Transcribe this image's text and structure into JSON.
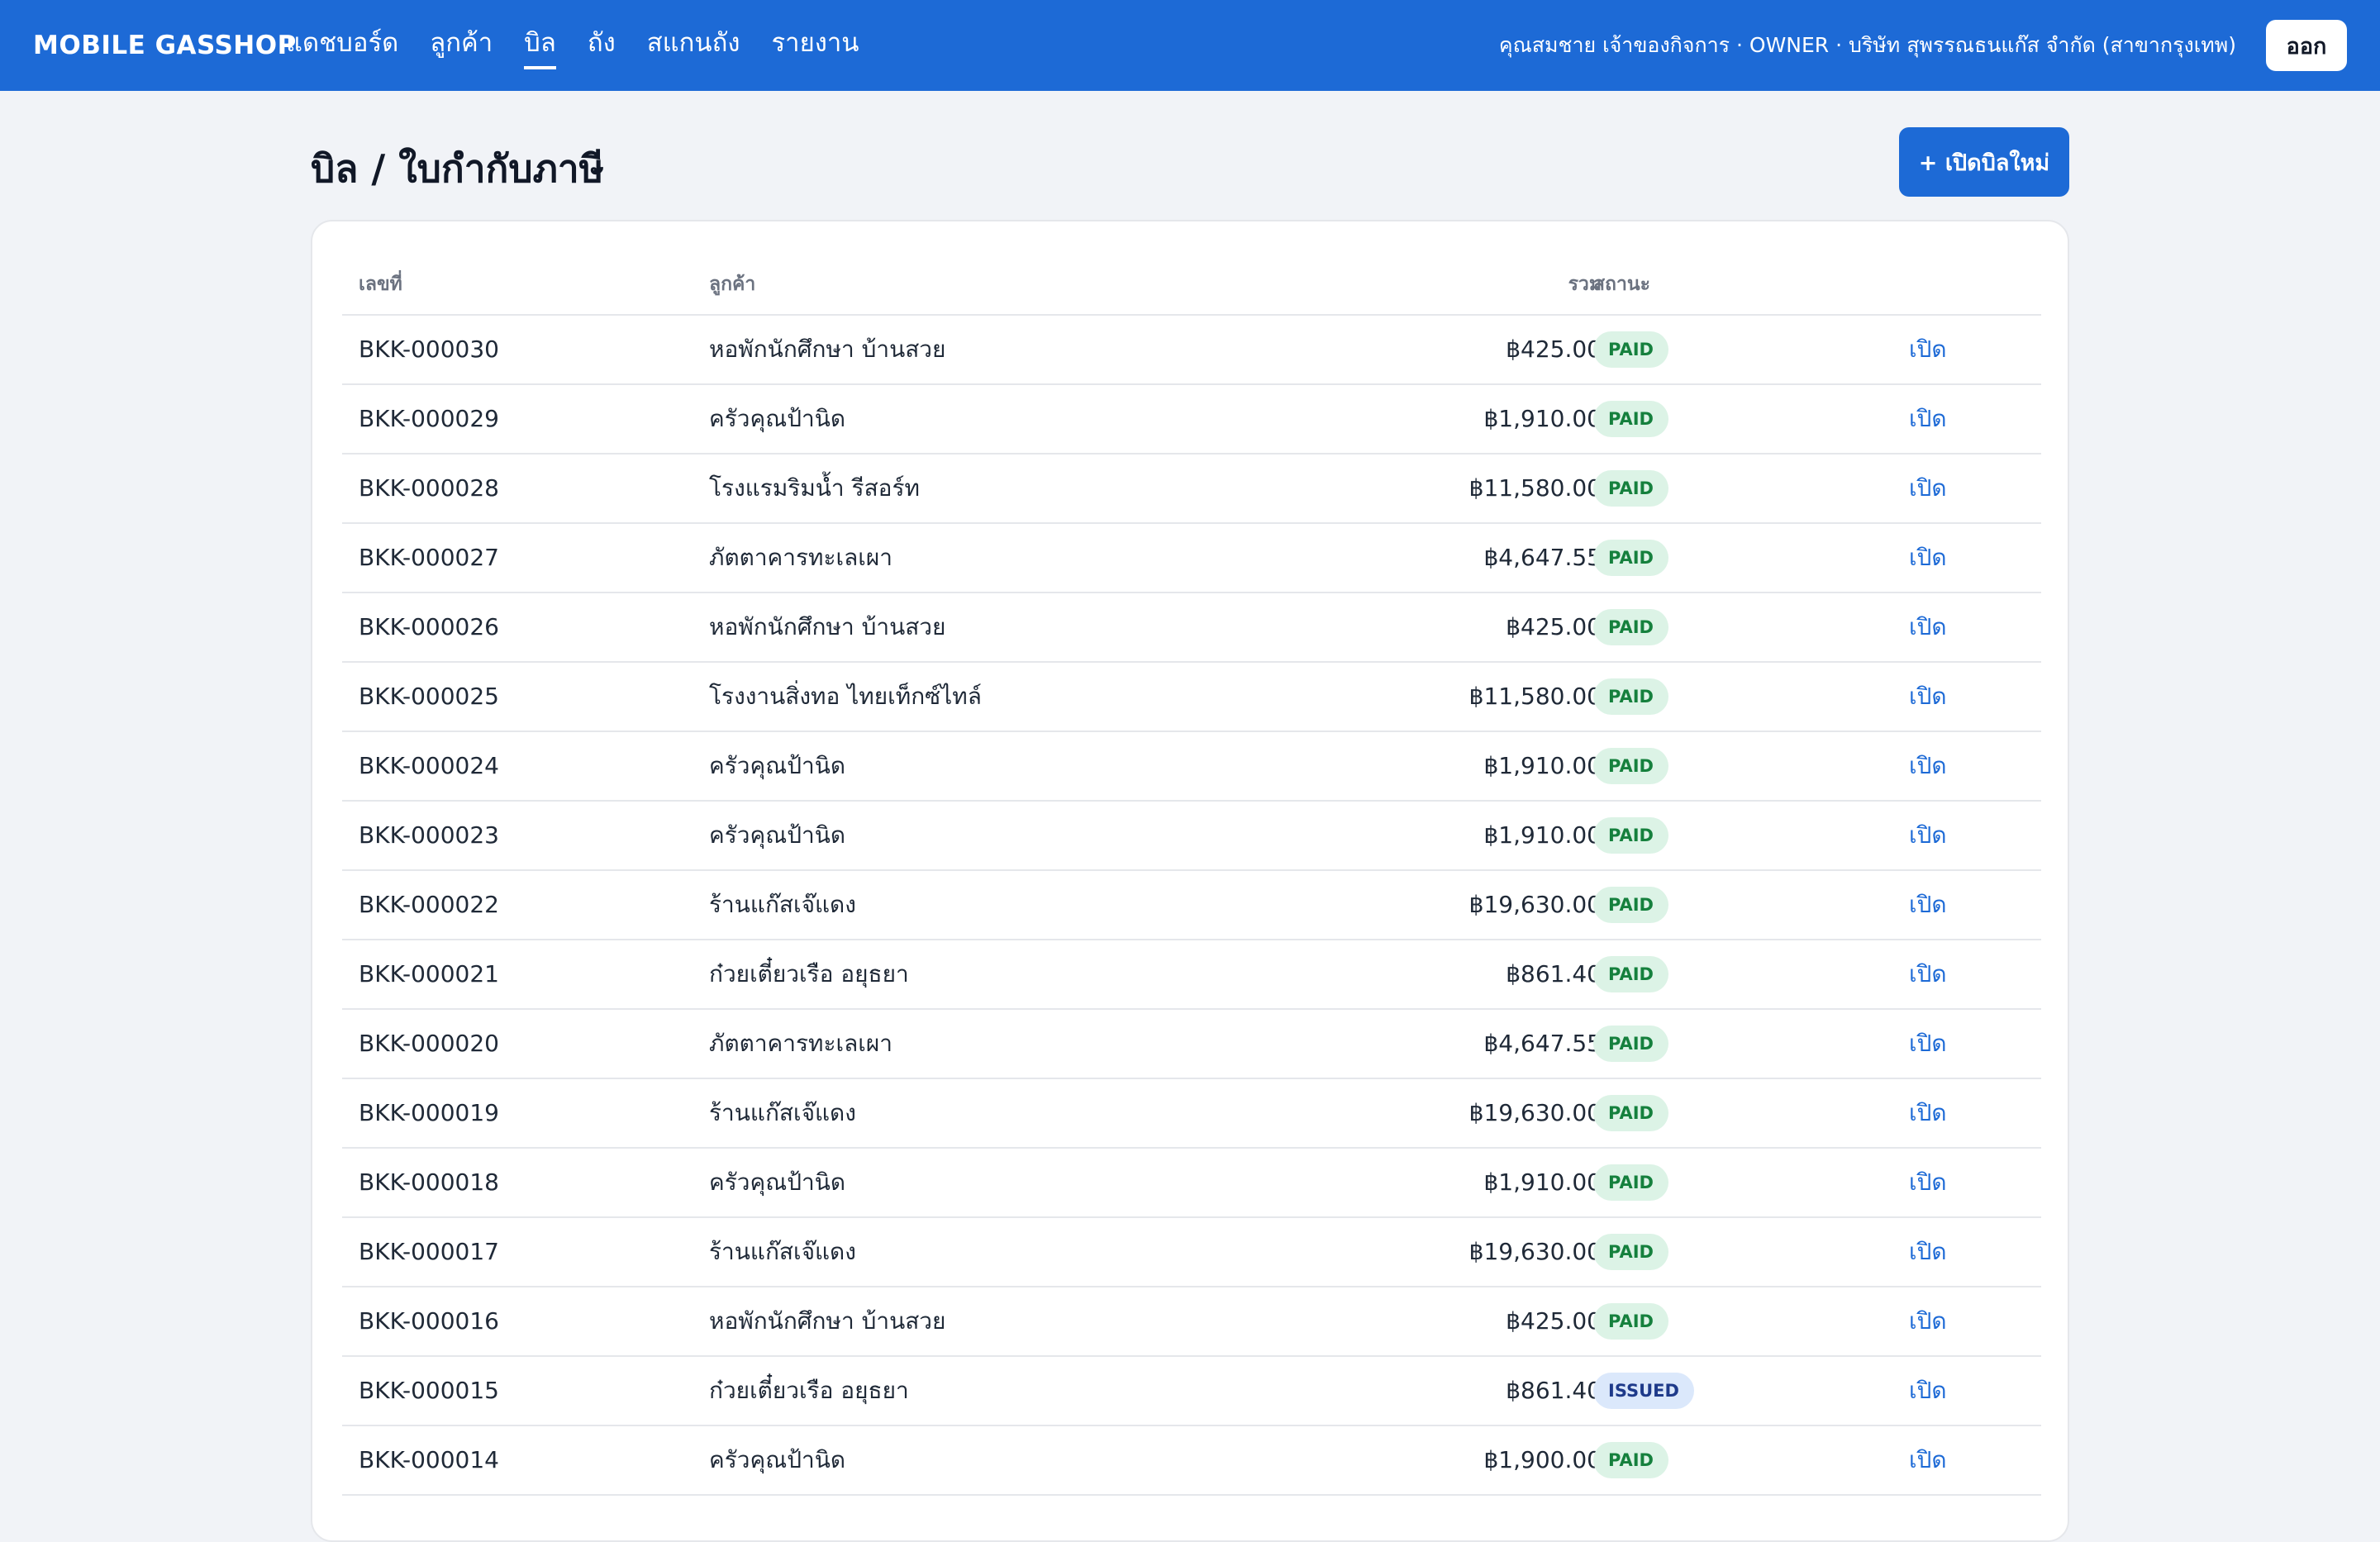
{
  "app": {
    "brand": "MOBILE GASSHOP",
    "nav": [
      {
        "label": "แดชบอร์ด",
        "active": false
      },
      {
        "label": "ลูกค้า",
        "active": false
      },
      {
        "label": "บิล",
        "active": true
      },
      {
        "label": "ถัง",
        "active": false
      },
      {
        "label": "สแกนถัง",
        "active": false
      },
      {
        "label": "รายงาน",
        "active": false
      }
    ],
    "user_info": "คุณสมชาย เจ้าของกิจการ · OWNER · บริษัท สุพรรณธนแก๊ส จำกัด (สาขากรุงเทพ)",
    "logout_label": "ออก"
  },
  "page": {
    "title": "บิล / ใบกำกับภาษี",
    "new_bill_label": "+ เปิดบิลใหม่"
  },
  "table": {
    "headers": {
      "no": "เลขที่",
      "customer": "ลูกค้า",
      "total": "รวม",
      "status": "สถานะ"
    },
    "open_label": "เปิด",
    "rows": [
      {
        "no": "BKK-000030",
        "customer": "หอพักนักศึกษา บ้านสวย",
        "total": "฿425.00",
        "status": "PAID"
      },
      {
        "no": "BKK-000029",
        "customer": "ครัวคุณป้านิด",
        "total": "฿1,910.00",
        "status": "PAID"
      },
      {
        "no": "BKK-000028",
        "customer": "โรงแรมริมน้ำ รีสอร์ท",
        "total": "฿11,580.00",
        "status": "PAID"
      },
      {
        "no": "BKK-000027",
        "customer": "ภัตตาคารทะเลเผา",
        "total": "฿4,647.55",
        "status": "PAID"
      },
      {
        "no": "BKK-000026",
        "customer": "หอพักนักศึกษา บ้านสวย",
        "total": "฿425.00",
        "status": "PAID"
      },
      {
        "no": "BKK-000025",
        "customer": "โรงงานสิ่งทอ ไทยเท็กซ์ไทล์",
        "total": "฿11,580.00",
        "status": "PAID"
      },
      {
        "no": "BKK-000024",
        "customer": "ครัวคุณป้านิด",
        "total": "฿1,910.00",
        "status": "PAID"
      },
      {
        "no": "BKK-000023",
        "customer": "ครัวคุณป้านิด",
        "total": "฿1,910.00",
        "status": "PAID"
      },
      {
        "no": "BKK-000022",
        "customer": "ร้านแก๊สเจ๊แดง",
        "total": "฿19,630.00",
        "status": "PAID"
      },
      {
        "no": "BKK-000021",
        "customer": "ก๋วยเตี๋ยวเรือ อยุธยา",
        "total": "฿861.40",
        "status": "PAID"
      },
      {
        "no": "BKK-000020",
        "customer": "ภัตตาคารทะเลเผา",
        "total": "฿4,647.55",
        "status": "PAID"
      },
      {
        "no": "BKK-000019",
        "customer": "ร้านแก๊สเจ๊แดง",
        "total": "฿19,630.00",
        "status": "PAID"
      },
      {
        "no": "BKK-000018",
        "customer": "ครัวคุณป้านิด",
        "total": "฿1,910.00",
        "status": "PAID"
      },
      {
        "no": "BKK-000017",
        "customer": "ร้านแก๊สเจ๊แดง",
        "total": "฿19,630.00",
        "status": "PAID"
      },
      {
        "no": "BKK-000016",
        "customer": "หอพักนักศึกษา บ้านสวย",
        "total": "฿425.00",
        "status": "PAID"
      },
      {
        "no": "BKK-000015",
        "customer": "ก๋วยเตี๋ยวเรือ อยุธยา",
        "total": "฿861.40",
        "status": "ISSUED"
      },
      {
        "no": "BKK-000014",
        "customer": "ครัวคุณป้านิด",
        "total": "฿1,900.00",
        "status": "PAID"
      }
    ]
  },
  "colors": {
    "primary": "#1d6ad6",
    "paid_bg": "#dcf3e6",
    "paid_fg": "#15803d",
    "issued_bg": "#dbe8fb",
    "issued_fg": "#1e3a8a"
  }
}
